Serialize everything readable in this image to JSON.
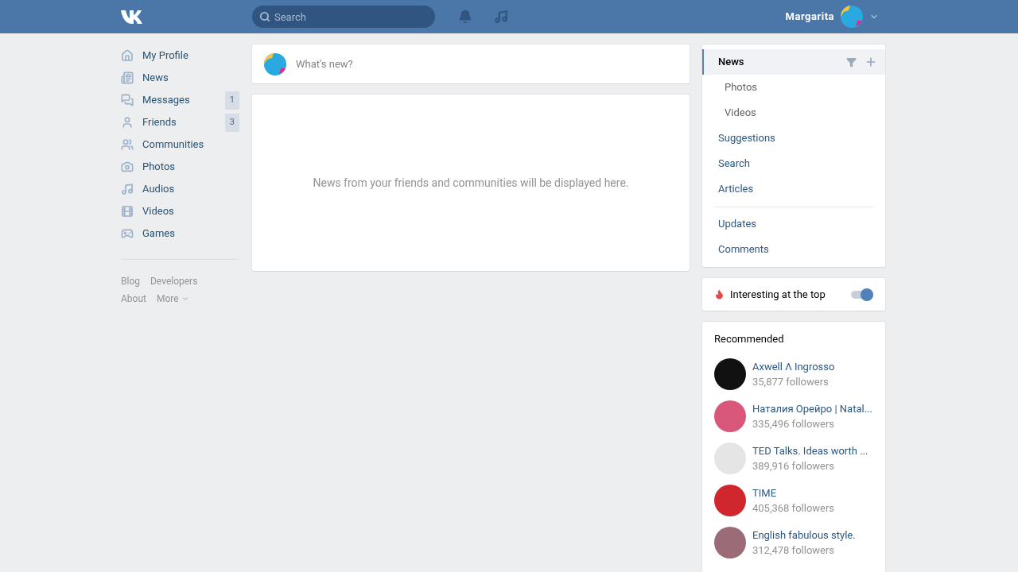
{
  "header": {
    "search": {
      "placeholder": "Search"
    },
    "user_name": "Margarita"
  },
  "sidebar": {
    "items": [
      {
        "label": "My Profile"
      },
      {
        "label": "News"
      },
      {
        "label": "Messages",
        "count": "1"
      },
      {
        "label": "Friends",
        "count": "3"
      },
      {
        "label": "Communities"
      },
      {
        "label": "Photos"
      },
      {
        "label": "Audios"
      },
      {
        "label": "Videos"
      },
      {
        "label": "Games"
      }
    ],
    "footer_links": [
      [
        "Blog",
        "Developers"
      ],
      [
        "About",
        "More"
      ]
    ]
  },
  "composer": {
    "placeholder": "What's new?"
  },
  "feed": {
    "empty_message": "News from your friends and communities will be displayed here."
  },
  "news_menu": {
    "groups": [
      [
        {
          "label": "News",
          "kind": "main",
          "selected": true
        },
        {
          "label": "Photos",
          "kind": "sub",
          "selected": false
        },
        {
          "label": "Videos",
          "kind": "sub",
          "selected": false
        },
        {
          "label": "Suggestions",
          "kind": "main",
          "selected": false
        },
        {
          "label": "Search",
          "kind": "main",
          "selected": false
        },
        {
          "label": "Articles",
          "kind": "main",
          "selected": false
        }
      ],
      [
        {
          "label": "Updates",
          "kind": "main",
          "selected": false
        },
        {
          "label": "Comments",
          "kind": "main",
          "selected": false
        }
      ]
    ]
  },
  "interesting_toggle": {
    "label": "Interesting at the top",
    "on": true
  },
  "recommended": {
    "title": "Recommended",
    "items": [
      {
        "name": "Axwell Λ Ingrosso",
        "followers": "35,877 followers",
        "color": "#111111"
      },
      {
        "name": "Наталия Орейро | Natal...",
        "followers": "335,496 followers",
        "color": "#d9577a"
      },
      {
        "name": "TED Talks. Ideas worth ...",
        "followers": "389,916 followers",
        "color": "#e5e5e5"
      },
      {
        "name": "TIME",
        "followers": "405,368 followers",
        "color": "#d0262d"
      },
      {
        "name": "English fabulous style.",
        "followers": "312,478 followers",
        "color": "#9b6b78"
      }
    ]
  }
}
